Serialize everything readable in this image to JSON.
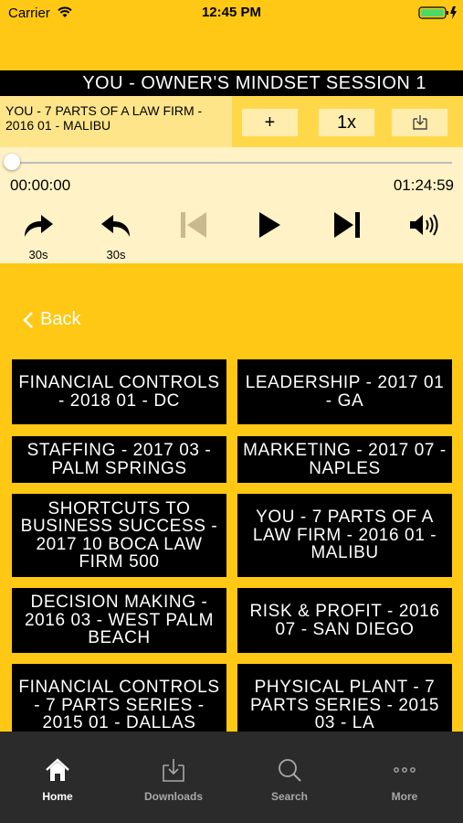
{
  "status_bar": {
    "carrier": "Carrier",
    "time": "12:45 PM"
  },
  "session_title": "YOU - OWNER'S MINDSET SESSION 1",
  "player": {
    "track_title": "YOU - 7 PARTS OF A LAW FIRM - 2016 01 - MALIBU",
    "add_label": "+",
    "speed_label": "1x",
    "elapsed": "00:00:00",
    "total": "01:24:59",
    "progress": 0,
    "forward_label": "30s",
    "rewind_label": "30s"
  },
  "back_label": "Back",
  "sessions": [
    "FINANCIAL CONTROLS - 2018 01 - DC",
    "LEADERSHIP - 2017 01 - GA",
    "STAFFING - 2017 03 - PALM SPRINGS",
    "MARKETING - 2017 07 - NAPLES",
    "SHORTCUTS TO BUSINESS SUCCESS - 2017 10 BOCA LAW FIRM 500",
    "YOU - 7 PARTS OF A LAW FIRM - 2016 01 - MALIBU",
    "DECISION MAKING - 2016 03 - WEST PALM BEACH",
    "RISK & PROFIT - 2016 07 - SAN DIEGO",
    "FINANCIAL CONTROLS - 7 PARTS SERIES - 2015 01 - DALLAS",
    "PHYSICAL PLANT - 7 PARTS SERIES - 2015 03 - LA"
  ],
  "tabs": [
    {
      "label": "Home",
      "icon": "home-icon",
      "active": true
    },
    {
      "label": "Downloads",
      "icon": "download-icon",
      "active": false
    },
    {
      "label": "Search",
      "icon": "search-icon",
      "active": false
    },
    {
      "label": "More",
      "icon": "more-icon",
      "active": false
    }
  ]
}
